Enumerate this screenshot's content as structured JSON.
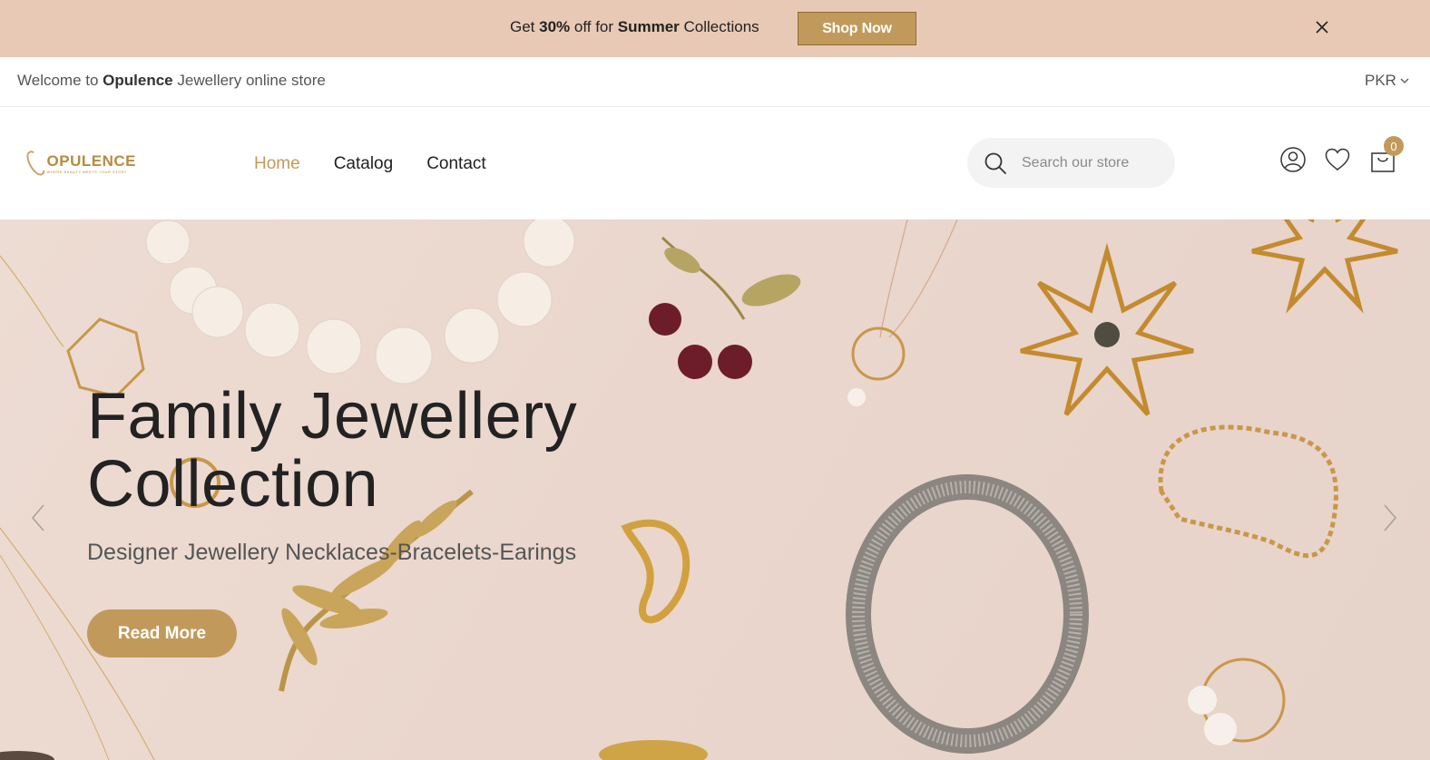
{
  "promo": {
    "text_prefix": "Get ",
    "text_discount": "30%",
    "text_middle": " off for ",
    "text_season": "Summer",
    "text_suffix": " Collections",
    "button_label": "Shop Now",
    "close_icon": "close-icon"
  },
  "welcome": {
    "prefix": "Welcome to ",
    "brand": "Opulence",
    "suffix": " Jewellery online store",
    "currency": "PKR"
  },
  "header": {
    "logo_text": "OPULENCE",
    "logo_tagline": "WHERE BEAUTY MEETS YOUR STORY",
    "nav": [
      {
        "label": "Home",
        "active": true
      },
      {
        "label": "Catalog",
        "active": false
      },
      {
        "label": "Contact",
        "active": false
      }
    ],
    "search_placeholder": "Search our store",
    "cart_count": "0",
    "icons": [
      "search-icon",
      "user-icon",
      "heart-icon",
      "cart-icon"
    ]
  },
  "hero": {
    "title_line1": "Family Jewellery",
    "title_line2": "Collection",
    "subtitle": "Designer Jewellery Necklaces-Bracelets-Earings",
    "button_label": "Read More"
  },
  "colors": {
    "accent": "#c19a5b",
    "promo_bg": "#e8c9b5",
    "hero_bg": "#ead6cc"
  }
}
